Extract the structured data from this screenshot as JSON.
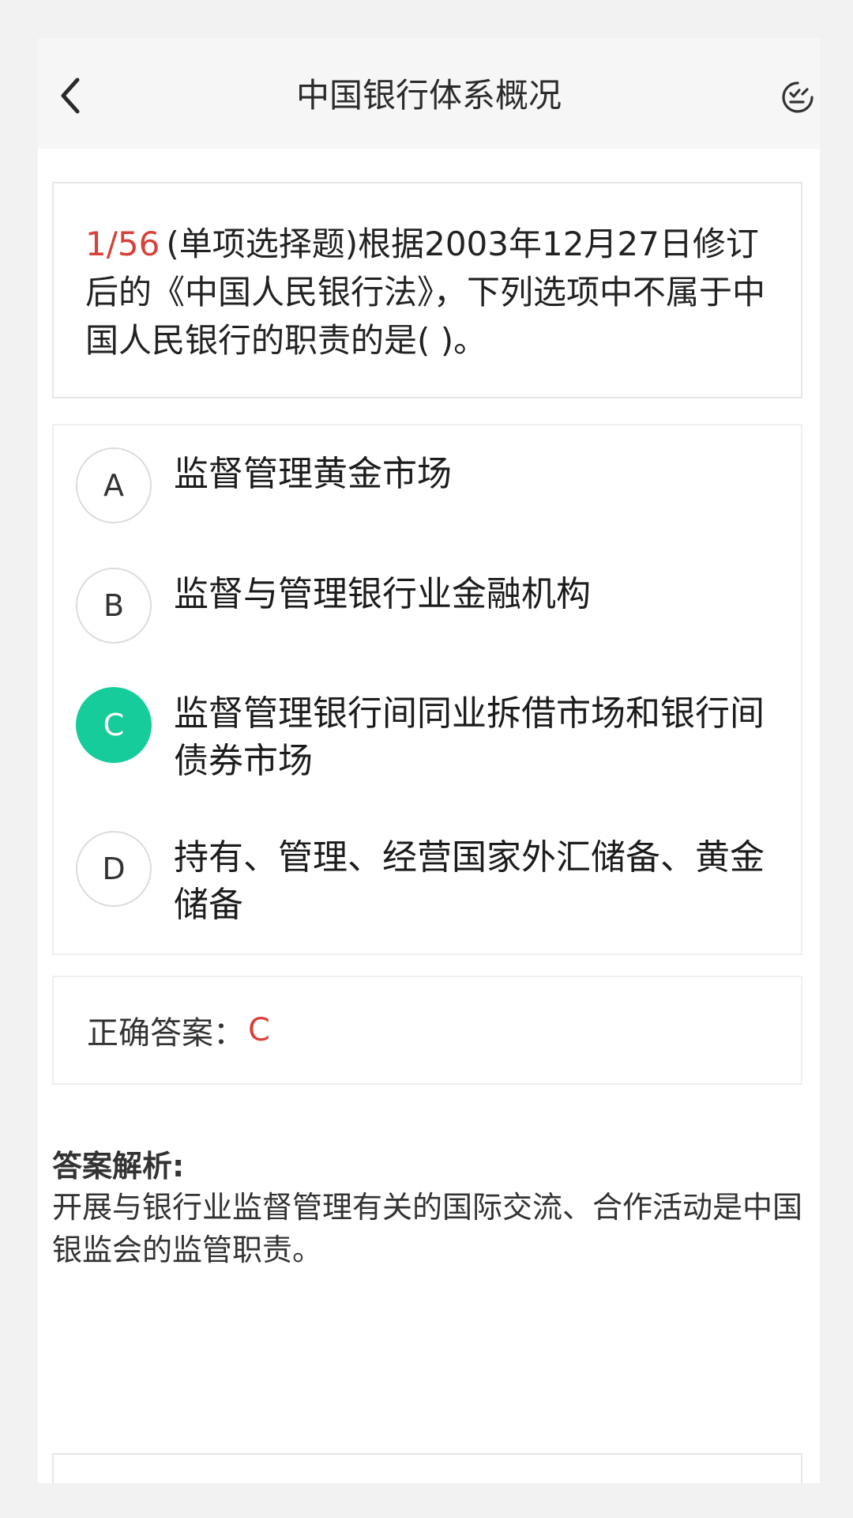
{
  "header": {
    "title": "中国银行体系概况",
    "back_icon": "chevron-left-icon",
    "action_icon": "check-list-icon"
  },
  "question": {
    "number": "1/56",
    "text": "(单项选择题)根据2003年12月27日修订后的《中国人民银行法》，下列选项中不属于中国人民银行的职责的是( )。"
  },
  "options": [
    {
      "letter": "A",
      "text": "监督管理黄金市场",
      "selected": false
    },
    {
      "letter": "B",
      "text": "监督与管理银行业金融机构",
      "selected": false
    },
    {
      "letter": "C",
      "text": "监督管理银行间同业拆借市场和银行间债券市场",
      "selected": true
    },
    {
      "letter": "D",
      "text": "持有、管理、经营国家外汇储备、黄金储备",
      "selected": false
    }
  ],
  "answer": {
    "label": "正确答案：",
    "value": "C"
  },
  "analysis": {
    "title": "答案解析:",
    "body": "开展与银行业监督管理有关的国际交流、合作活动是中国银监会的监管职责。"
  },
  "colors": {
    "accent": "#16cc9a",
    "highlight_red": "#d8413a",
    "background": "#f2f2f2",
    "header_bg": "#f6f6f6"
  }
}
